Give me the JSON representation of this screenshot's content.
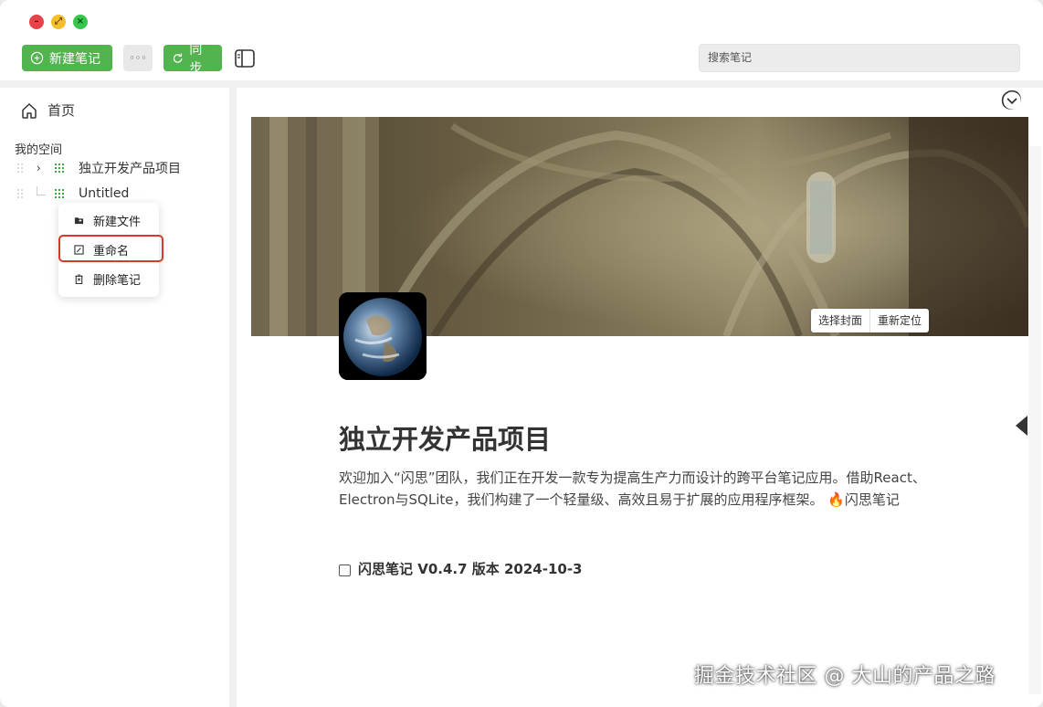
{
  "toolbar": {
    "new_note_label": "新建笔记",
    "more_label": "◦◦◦",
    "sync_label": "同步",
    "search_placeholder": "搜索笔记"
  },
  "sidebar": {
    "home_label": "首页",
    "space_title": "我的空间",
    "tree": [
      {
        "label": "独立开发产品项目"
      },
      {
        "label": "Untitled"
      }
    ]
  },
  "context_menu": {
    "items": [
      {
        "label": "新建文件"
      },
      {
        "label": "重命名"
      },
      {
        "label": "删除笔记"
      }
    ]
  },
  "cover": {
    "choose_label": "选择封面",
    "reposition_label": "重新定位"
  },
  "document": {
    "title": "独立开发产品项目",
    "paragraph": "欢迎加入“闪思”团队，我们正在开发一款专为提高生产力而设计的跨平台笔记应用。借助React、Electron与SQLite，我们构建了一个轻量级、高效且易于扩展的应用程序框架。 🔥闪思笔记",
    "todo": "闪思笔记 V0.4.7 版本 2024-10-3"
  },
  "watermark": "掘金技术社区 @ 大山的产品之路",
  "colors": {
    "accent_green": "#52b44e",
    "highlight_red": "#d63a2d"
  }
}
